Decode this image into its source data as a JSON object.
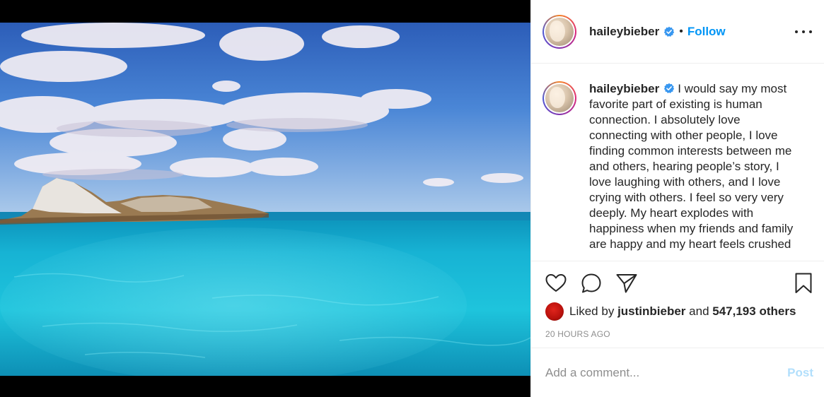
{
  "post": {
    "image_alt": "",
    "author": {
      "username": "haileybieber",
      "verified": true,
      "follow_label": "Follow",
      "separator": "•"
    },
    "caption": {
      "username": "haileybieber",
      "text": "I would say my most favorite part of existing is human connection. I absolutely love connecting with other people, I love finding common interests between me and others, hearing people’s story, I love laughing with others, and I love crying with others. I feel so very very deeply. My heart explodes with happiness when my friends and family are happy and my heart feels crushed"
    },
    "likes": {
      "prefix": "Liked by",
      "liker": "justinbieber",
      "connector": "and",
      "count": "547,193 others"
    },
    "timestamp": "20 HOURS AGO"
  },
  "comment": {
    "placeholder": "Add a comment...",
    "post_label": "Post"
  },
  "icons": {
    "like": "heart-icon",
    "comment": "comment-icon",
    "share": "share-icon",
    "save": "bookmark-icon",
    "more": "more-options-icon",
    "verified": "verified-badge-icon"
  },
  "colors": {
    "accent": "#0095f6",
    "post_disabled": "#b2dffc",
    "muted": "#8e8e8e"
  }
}
